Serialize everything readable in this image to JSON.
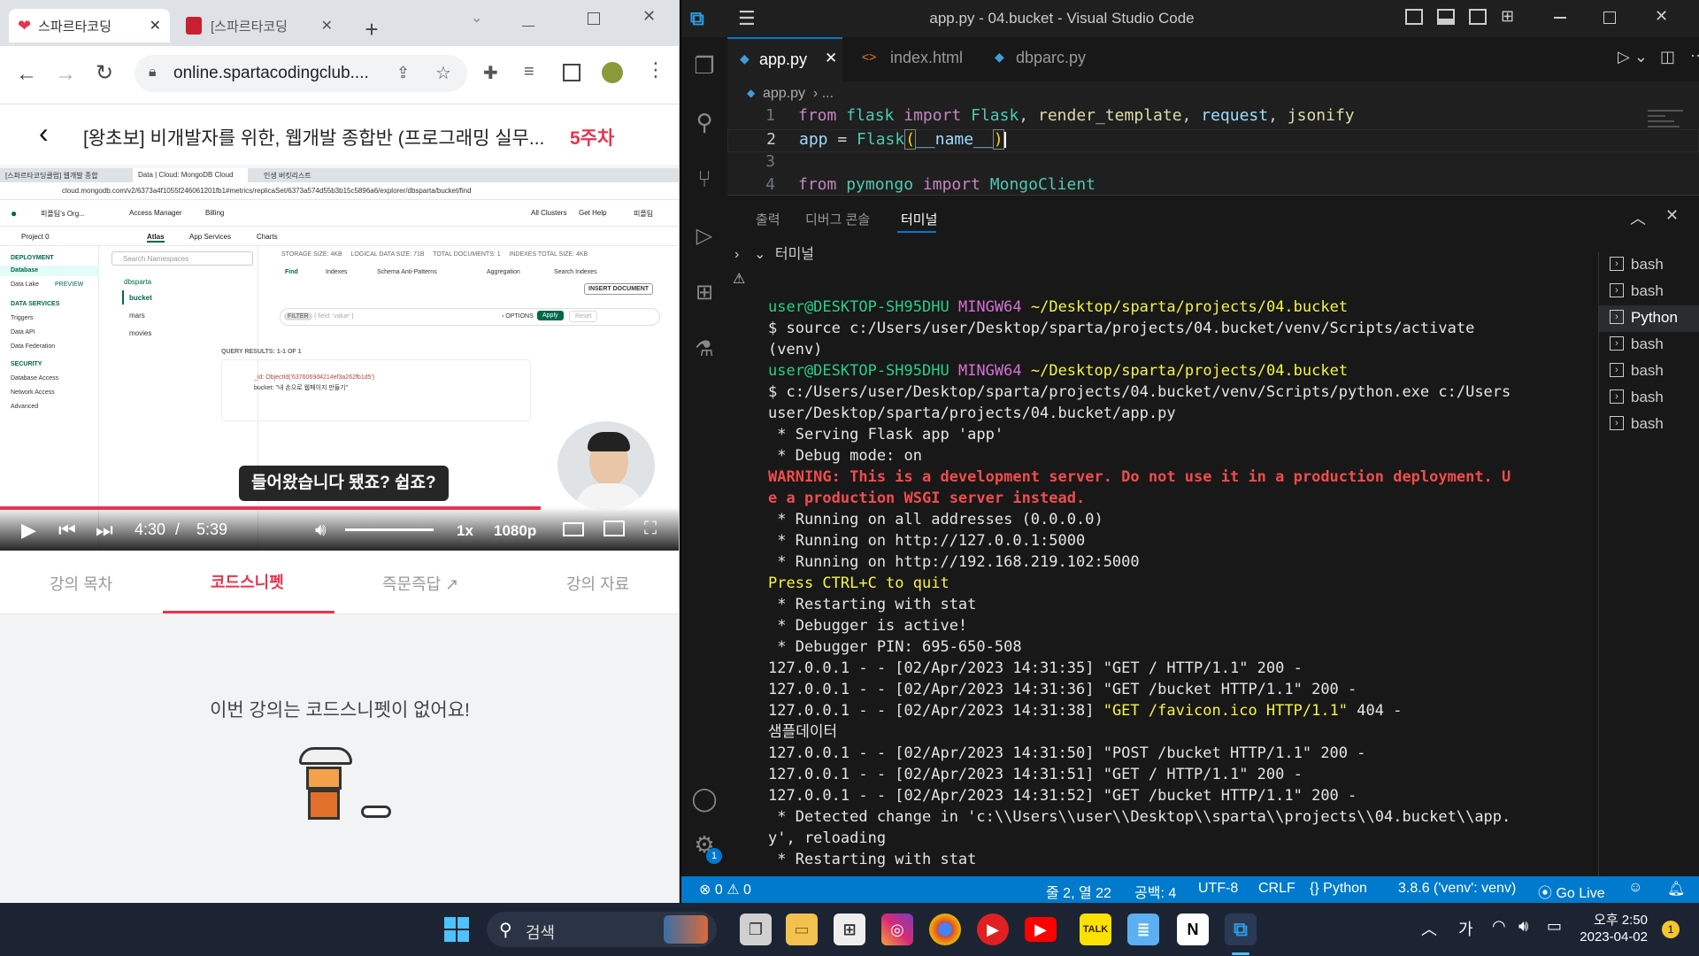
{
  "browser": {
    "tabs": [
      {
        "label": "스파르타코딩"
      },
      {
        "label": "[스파르타코딩"
      }
    ],
    "url": "online.spartacodingclub....",
    "course_title": "[왕초보] 비개발자를 위한, 웹개발 종합반 (프로그래밍 실무...",
    "week": "5주차",
    "video": {
      "subtitle": "들어왔습니다 됐죠? 쉽죠?",
      "time_current": "4:30",
      "time_sep": "/",
      "time_total": "5:39",
      "speed": "1x",
      "quality": "1080p",
      "progress": 0.796
    },
    "inner_browser": {
      "tabs": [
        "[스파르타코딩클럽] 웹개발 종합",
        "Data | Cloud: MongoDB Cloud",
        "인생 버킷리스트"
      ],
      "url": "cloud.mongodb.com/v2/6373a4f1055f246061201fb1#metrics/replicaSet/6373a574d55b3b15c5896a6/explorer/dbsparta/bucket/find",
      "org": "피플팀's Org...",
      "access_manager": "Access Manager",
      "billing": "Billing",
      "all_clusters": "All Clusters",
      "get_help": "Get Help",
      "user": "피플팀",
      "project": "Project 0",
      "nav_tabs": [
        "Atlas",
        "App Services",
        "Charts"
      ],
      "sidebar": {
        "deployment": "DEPLOYMENT",
        "database": "Database",
        "data_lake": "Data Lake",
        "preview": "PREVIEW",
        "data_services": "DATA SERVICES",
        "triggers": "Triggers",
        "data_api": "Data API",
        "data_federation": "Data Federation",
        "security": "SECURITY",
        "database_access": "Database Access",
        "network_access": "Network Access",
        "advanced": "Advanced"
      },
      "search_placeholder": "Search Namespaces",
      "db_name": "dbsparta",
      "collections": [
        "bucket",
        "mars",
        "movies"
      ],
      "stats": "STORAGE SIZE: 4KB     LOGICAL DATA SIZE: 71B     TOTAL DOCUMENTS: 1     INDEXES TOTAL SIZE: 4KB",
      "sub_tabs": [
        "Find",
        "Indexes",
        "Schema Anti-Patterns",
        "Aggregation",
        "Search Indexes"
      ],
      "insert_doc": "INSERT DOCUMENT",
      "filter_label": "FILTER",
      "filter_placeholder": "{ field: 'value' }",
      "options": "› OPTIONS",
      "apply": "Apply",
      "reset": "Reset",
      "query_results": "QUERY RESULTS: 1-1 OF 1",
      "doc_id": "_id: ObjectId('6376069d4214ef3a262fb1d5')",
      "doc_bucket": "bucket: \"내 손으로 웹페이지 만들기\""
    },
    "lecture_tabs": [
      "강의 목차",
      "코드스니펫",
      "즉문즉답",
      "강의 자료"
    ],
    "empty_message": "이번 강의는 코드스니펫이 없어요!"
  },
  "vscode": {
    "title": "app.py - 04.bucket - Visual Studio Code",
    "tabs": [
      "app.py",
      "index.html",
      "dbparc.py"
    ],
    "breadcrumb": "app.py  › ...",
    "code": [
      {
        "n": "1",
        "text": "from flask import Flask, render_template, request, jsonify"
      },
      {
        "n": "2",
        "text": "app = Flask(__name__)"
      },
      {
        "n": "3",
        "text": ""
      },
      {
        "n": "4",
        "text": "from pymongo import MongoClient"
      }
    ],
    "panel_tabs": [
      "출력",
      "디버그 콘솔",
      "터미널"
    ],
    "terminal_header": "터미널",
    "terminal": {
      "p1_user": "user@DESKTOP-SH95DHU",
      "p1_env": "MINGW64",
      "p1_path": "~/Desktop/sparta/projects/04.bucket",
      "cmd1": "$ source c:/Users/user/Desktop/sparta/projects/04.bucket/venv/Scripts/activate",
      "venv": "(venv)",
      "cmd2a": "$ c:/Users/user/Desktop/sparta/projects/04.bucket/venv/Scripts/python.exe c:/Users/",
      "cmd2b": "user/Desktop/sparta/projects/04.bucket/app.py",
      "l1": " * Serving Flask app 'app'",
      "l2": " * Debug mode: on",
      "warn1": "WARNING: This is a development server. Do not use it in a production deployment. Us",
      "warn2": "e a production WSGI server instead.",
      "l3": " * Running on all addresses (0.0.0.0)",
      "l4": " * Running on http://127.0.0.1:5000",
      "l5": " * Running on http://192.168.219.102:5000",
      "quit": "Press CTRL+C to quit",
      "l6": " * Restarting with stat",
      "l7": " * Debugger is active!",
      "l8": " * Debugger PIN: 695-650-508",
      "r1": "127.0.0.1 - - [02/Apr/2023 14:31:35] \"GET / HTTP/1.1\" 200 -",
      "r2": "127.0.0.1 - - [02/Apr/2023 14:31:36] \"GET /bucket HTTP/1.1\" 200 -",
      "r3a": "127.0.0.1 - - [02/Apr/2023 14:31:38] ",
      "r3b": "\"GET /favicon.ico HTTP/1.1\"",
      "r3c": " 404 -",
      "sample": "샘플데이터",
      "r4": "127.0.0.1 - - [02/Apr/2023 14:31:50] \"POST /bucket HTTP/1.1\" 200 -",
      "r5": "127.0.0.1 - - [02/Apr/2023 14:31:51] \"GET / HTTP/1.1\" 200 -",
      "r6": "127.0.0.1 - - [02/Apr/2023 14:31:52] \"GET /bucket HTTP/1.1\" 200 -",
      "r7a": " * Detected change in 'c:\\\\Users\\\\user\\\\Desktop\\\\sparta\\\\projects\\\\04.bucket\\\\app.p",
      "r7b": "y', reloading",
      "r8": " * Restarting with stat"
    },
    "terminal_list": [
      "bash",
      "bash",
      "Python",
      "bash",
      "bash",
      "bash",
      "bash"
    ],
    "status": {
      "errors": "⊗ 0 ⚠ 0",
      "position": "줄 2, 열 22",
      "spaces": "공백: 4",
      "encoding": "UTF-8",
      "eol": "CRLF",
      "language": "Python",
      "interpreter": "3.8.6 ('venv': venv)",
      "golive": "Go Live"
    },
    "settings_badge": "1"
  },
  "taskbar": {
    "search": "검색",
    "ime": "가",
    "time": "오후 2:50",
    "date": "2023-04-02",
    "notif": "1"
  },
  "colors": {
    "accent": "#e8344e",
    "vscode_blue": "#007acc",
    "mongo_green": "#00684a"
  }
}
